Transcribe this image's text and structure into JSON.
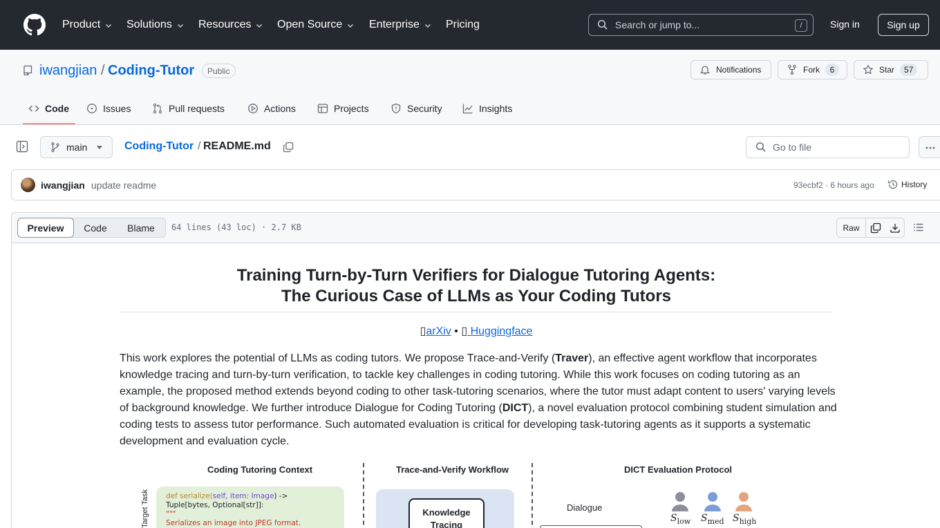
{
  "header": {
    "nav": [
      {
        "label": "Product",
        "has_menu": true
      },
      {
        "label": "Solutions",
        "has_menu": true
      },
      {
        "label": "Resources",
        "has_menu": true
      },
      {
        "label": "Open Source",
        "has_menu": true
      },
      {
        "label": "Enterprise",
        "has_menu": true
      },
      {
        "label": "Pricing",
        "has_menu": false
      }
    ],
    "search_placeholder": "Search or jump to...",
    "search_shortcut": "/",
    "sign_in": "Sign in",
    "sign_up": "Sign up"
  },
  "repo": {
    "owner": "iwangjian",
    "separator": "/",
    "name": "Coding-Tutor",
    "visibility": "Public",
    "notifications_label": "Notifications",
    "fork_label": "Fork",
    "fork_count": "6",
    "star_label": "Star",
    "star_count": "57"
  },
  "tabs": [
    {
      "label": "Code",
      "icon": "code-icon",
      "active": true
    },
    {
      "label": "Issues",
      "icon": "issue-icon"
    },
    {
      "label": "Pull requests",
      "icon": "pull-request-icon"
    },
    {
      "label": "Actions",
      "icon": "play-icon"
    },
    {
      "label": "Projects",
      "icon": "table-icon"
    },
    {
      "label": "Security",
      "icon": "shield-icon"
    },
    {
      "label": "Insights",
      "icon": "graph-icon"
    }
  ],
  "filenav": {
    "branch": "main",
    "repo_crumb": "Coding-Tutor",
    "separator": "/",
    "file_crumb": "README.md",
    "goto_placeholder": "Go to file"
  },
  "commit": {
    "author": "iwangjian",
    "message": "update readme",
    "hash_time": "93ecbf2 · 6 hours ago",
    "history_label": "History"
  },
  "filehead": {
    "views": [
      "Preview",
      "Code",
      "Blame"
    ],
    "active_view": "Preview",
    "info": "64 lines (43 loc) · 2.7 KB",
    "raw_label": "Raw"
  },
  "readme": {
    "title_line1": "Training Turn-by-Turn Verifiers for Dialogue Tutoring Agents:",
    "title_line2": "The Curious Case of LLMs as Your Coding Tutors",
    "link_arxiv": "arXiv",
    "link_sep": " • ",
    "link_hf": " Huggingface",
    "p1_a": "This work explores the potential of LLMs as coding tutors. We propose Trace-and-Verify (",
    "p1_traver": "Traver",
    "p1_b": "), an effective agent workflow that incorporates knowledge tracing and turn-by-turn verification, to tackle key challenges in coding tutoring. While this work focuses on coding tutoring as an example, the proposed method extends beyond coding to other task-tutoring scenarios, where the tutor must adapt content to users' varying levels of background knowledge. We further introduce Dialogue for Coding Tutoring (",
    "p1_dict": "DICT",
    "p1_c": "), a novel evaluation protocol combining student simulation and coding tests to assess tutor performance. Such automated evaluation is critical for developing task-tutoring agents as it supports a systematic development and evaluation cycle."
  },
  "figure": {
    "h1": "Coding Tutoring Context",
    "h2": "Trace-and-Verify Workflow",
    "h3": "DICT Evaluation Protocol",
    "target_task": "Target Task",
    "code_line1_kw": "def ",
    "code_line1_fn": "serialize(",
    "code_line1_args": "self,  item: Image",
    "code_line1_end": ") ->",
    "code_line2": "Tuple[bytes, Optional[str]]:",
    "code_line3": "\"\"\"",
    "code_line4": "Serializes an image into JPEG format.",
    "trace_label": "Knowledge Tracing",
    "dialogue_label": "Dialogue",
    "students": [
      {
        "sym": "S",
        "sub": "low",
        "color": "#8c8f99"
      },
      {
        "sym": "S",
        "sub": "med",
        "color": "#7e9fd6"
      },
      {
        "sym": "S",
        "sub": "high",
        "color": "#e3a47e"
      }
    ]
  }
}
